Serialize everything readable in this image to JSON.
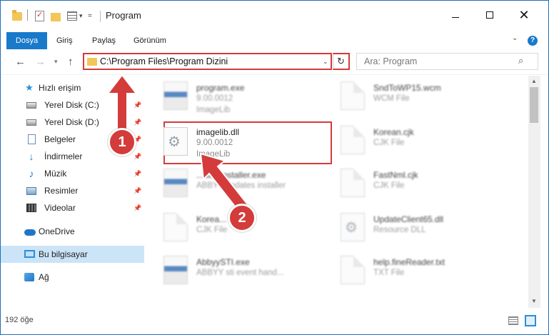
{
  "window": {
    "title": "Program"
  },
  "ribbon": {
    "tabs": [
      {
        "label": "Dosya"
      },
      {
        "label": "Giriş"
      },
      {
        "label": "Paylaş"
      },
      {
        "label": "Görünüm"
      }
    ],
    "help": "?"
  },
  "navbar": {
    "address": "C:\\Program Files\\Program Dizini",
    "search_placeholder": "Ara: Program"
  },
  "sidebar": {
    "items": [
      {
        "label": "Hızlı erişim",
        "icon": "star-icon"
      },
      {
        "label": "Yerel Disk (C:)",
        "icon": "drive-icon",
        "pinned": true
      },
      {
        "label": "Yerel Disk (D:)",
        "icon": "drive-icon",
        "pinned": true
      },
      {
        "label": "Belgeler",
        "icon": "documents-icon",
        "pinned": true
      },
      {
        "label": "İndirmeler",
        "icon": "downloads-icon",
        "pinned": true
      },
      {
        "label": "Müzik",
        "icon": "music-icon",
        "pinned": true
      },
      {
        "label": "Resimler",
        "icon": "pictures-icon",
        "pinned": true
      },
      {
        "label": "Videolar",
        "icon": "videos-icon",
        "pinned": true
      },
      {
        "label": "OneDrive",
        "icon": "onedrive-icon"
      },
      {
        "label": "Bu bilgisayar",
        "icon": "computer-icon",
        "selected": true
      },
      {
        "label": "Ağ",
        "icon": "network-icon"
      }
    ]
  },
  "files": [
    {
      "name": "program.exe",
      "line1": "9.00.0012",
      "line2": "ImageLib"
    },
    {
      "name": "SndToWP15.wcm",
      "line1": "WCM File",
      "line2": ""
    },
    {
      "name": "imagelib.dll",
      "line1": "9.00.0012",
      "line2": "ImageLib"
    },
    {
      "name": "Korean.cjk",
      "line1": "CJK File",
      "line2": ""
    },
    {
      "name": "...dateInstaller.exe",
      "line1": "ABBYY updates installer",
      "line2": ""
    },
    {
      "name": "FastNml.cjk",
      "line1": "CJK File",
      "line2": ""
    },
    {
      "name": "Korea...",
      "line1": "CJK File",
      "line2": ""
    },
    {
      "name": "UpdateClient65.dll",
      "line1": "Resource DLL",
      "line2": ""
    },
    {
      "name": "AbbyySTI.exe",
      "line1": "ABBYY sti event hand...",
      "line2": ""
    },
    {
      "name": "help.fineReader.txt",
      "line1": "TXT File",
      "line2": ""
    }
  ],
  "status": {
    "count": "192 öğe"
  },
  "callouts": {
    "one": "1",
    "two": "2"
  },
  "colors": {
    "accent": "#1979ca",
    "highlight": "#d43b3b",
    "selected": "#cce4f7"
  }
}
